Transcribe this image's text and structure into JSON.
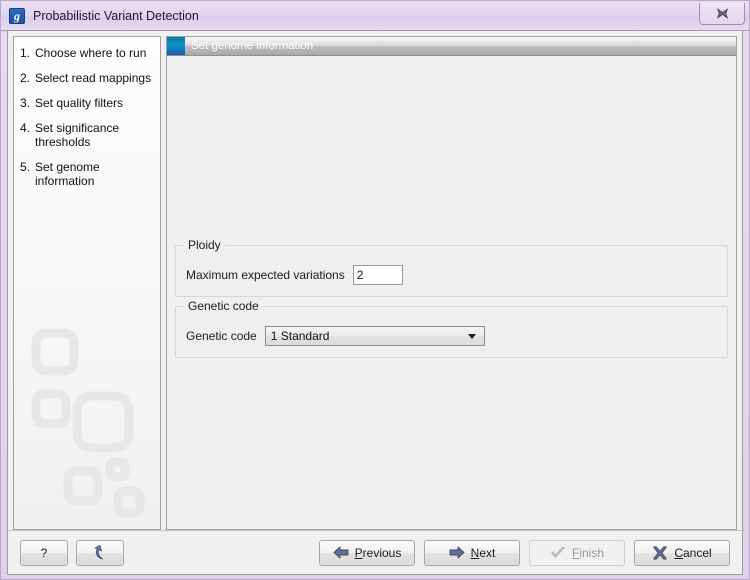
{
  "window": {
    "title": "Probabilistic Variant Detection",
    "app_icon": "genomics-workbench-icon",
    "icon_glyph": "g",
    "close_label": "Close",
    "frame_color": "#ded0ea",
    "titlebar_color": "#e3d6ef"
  },
  "sidebar": {
    "steps": [
      {
        "num": "1.",
        "label": "Choose where to run"
      },
      {
        "num": "2.",
        "label": "Select read mappings"
      },
      {
        "num": "3.",
        "label": "Set quality filters"
      },
      {
        "num": "4.",
        "label": "Set significance thresholds"
      },
      {
        "num": "5.",
        "label": "Set genome information"
      }
    ]
  },
  "content": {
    "header_title": "Set genome information",
    "header_icon": "step-square-icon",
    "header_accent": "#0a86b8",
    "groups": [
      {
        "title": "Ploidy",
        "field_label": "Maximum expected variations",
        "field_type": "text",
        "value": "2"
      },
      {
        "title": "Genetic code",
        "field_label": "Genetic code",
        "field_type": "combo",
        "value": "1 Standard",
        "options": [
          "1 Standard"
        ]
      }
    ]
  },
  "buttons": {
    "help": {
      "label": "?",
      "icon": "question-mark-icon"
    },
    "reset": {
      "label": "",
      "icon": "undo-arrow-icon"
    },
    "previous": {
      "label": "Previous",
      "mnemonic": "P",
      "rest": "revious",
      "icon": "arrow-left-icon",
      "enabled": true
    },
    "next": {
      "label": "Next",
      "mnemonic": "N",
      "rest": "ext",
      "icon": "arrow-right-icon",
      "enabled": true
    },
    "finish": {
      "label": "Finish",
      "mnemonic": "F",
      "rest": "inish",
      "icon": "checkmark-icon",
      "enabled": false
    },
    "cancel": {
      "label": "Cancel",
      "mnemonic": "C",
      "rest": "ancel",
      "icon": "cross-icon",
      "enabled": true
    }
  }
}
